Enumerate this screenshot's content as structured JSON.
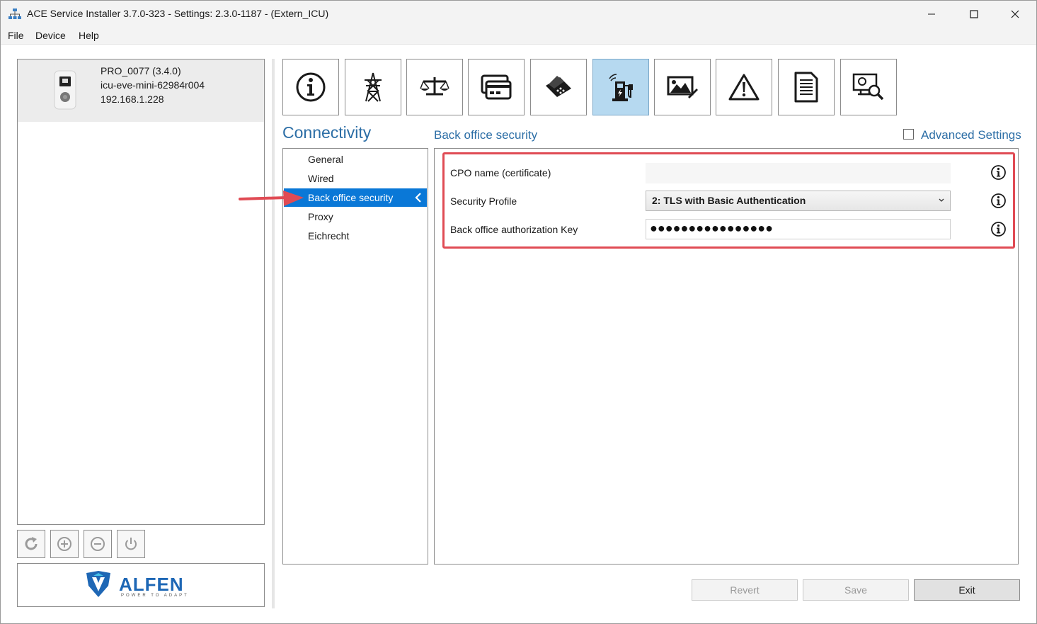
{
  "window": {
    "title": "ACE Service Installer 3.7.0-323 - Settings: 2.3.0-1187 -  (Extern_ICU)",
    "controls": [
      "minimize",
      "maximize",
      "close"
    ]
  },
  "menu": [
    "File",
    "Device",
    "Help"
  ],
  "device": {
    "name": "PRO_0077 (3.4.0)",
    "hostname": "icu-eve-mini-62984r004",
    "ip": "192.168.1.228"
  },
  "left_toolbar": [
    "refresh-icon",
    "add-circle-icon",
    "remove-circle-icon",
    "power-icon"
  ],
  "logo": {
    "text": "ALFEN",
    "tagline": "POWER TO ADAPT"
  },
  "toolbar_icons": [
    "info-icon",
    "power-tower-icon",
    "balance-scale-icon",
    "card-reader-icon",
    "payment-terminal-icon",
    "charging-connectivity-icon",
    "display-image-icon",
    "warning-icon",
    "document-icon",
    "monitor-search-icon"
  ],
  "active_tool": "charging-connectivity-icon",
  "section": {
    "title": "Connectivity"
  },
  "nav": {
    "items": [
      "General",
      "Wired",
      "Back office security",
      "Proxy",
      "Eichrecht"
    ],
    "selected": "Back office security"
  },
  "page": {
    "subtitle": "Back office security",
    "advanced_settings_label": "Advanced Settings",
    "advanced_settings_checked": false
  },
  "fields": {
    "cpo_name": {
      "label": "CPO name (certificate)",
      "value": ""
    },
    "security_profile": {
      "label": "Security Profile",
      "value": "2: TLS with Basic Authentication"
    },
    "auth_key": {
      "label": "Back office authorization Key",
      "value": "●●●●●●●●●●●●●●●●"
    }
  },
  "buttons": {
    "revert": "Revert",
    "save": "Save",
    "exit": "Exit"
  },
  "colors": {
    "accent": "#2c6ea6",
    "selection": "#0a78d7",
    "highlight": "#e04b54",
    "active_tool": "#b6d9f0"
  }
}
